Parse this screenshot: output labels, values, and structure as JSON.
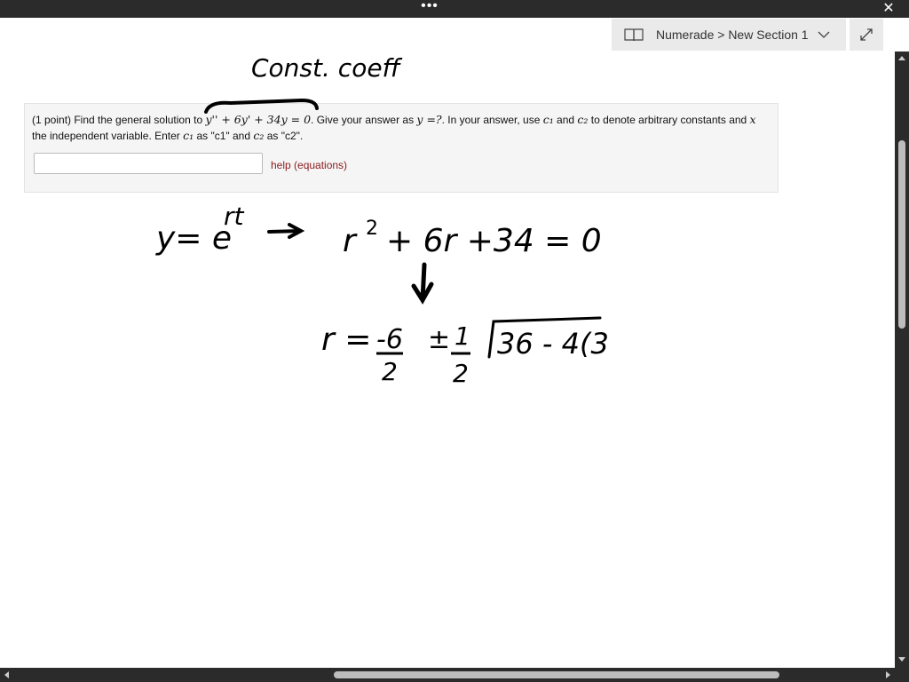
{
  "titlebar": {
    "more": "•••",
    "close": "✕"
  },
  "notebook": {
    "breadcrumb": "Numerade > New Section 1",
    "book_icon": "book-icon",
    "chevron_icon": "chevron-down-icon"
  },
  "expand": {
    "icon": "expand-icon"
  },
  "problem": {
    "prefix": "(1 point) Find the general solution to ",
    "equation": "y'' + 6y' + 34y = 0",
    "middle": ". Give your answer as ",
    "answer_form": "y =?",
    "after_form": ". In your answer, use ",
    "c1": "c₁",
    "and_word": " and ",
    "c2": "c₂",
    "tail1": " to denote arbitrary constants and ",
    "x_var": "x",
    "line2_a": "the independent variable. Enter ",
    "c1_b": "c₁",
    "line2_b": " as \"c1\" and ",
    "c2_b": "c₂",
    "line2_c": " as \"c2\".",
    "input_value": "",
    "help_label": "help (equations)"
  },
  "ink": {
    "note_top": "Const. coeff",
    "guess_left": "y= e",
    "guess_exp": "rt",
    "char_eq_r": "r",
    "char_eq_sq": "2",
    "char_eq_rest": "+ 6r +34 = 0",
    "r_label": "r =",
    "frac1_num": "-6",
    "frac1_den": "2",
    "pm": "±",
    "frac2_num": "1",
    "frac2_den": "2",
    "radicand": "36 - 4(3"
  }
}
